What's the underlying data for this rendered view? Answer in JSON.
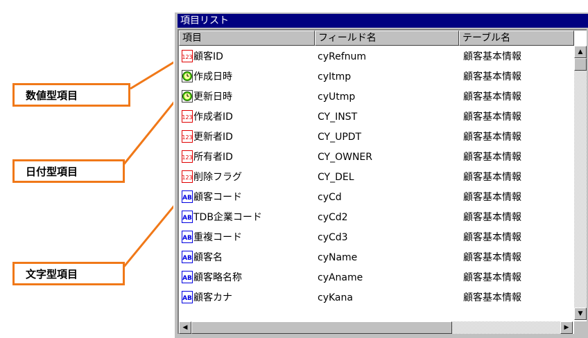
{
  "window": {
    "title": "項目リスト"
  },
  "columns": [
    "項目",
    "フィールド名",
    "テーブル名"
  ],
  "rows": [
    {
      "type": "number",
      "name": "顧客ID",
      "field": "cyRefnum",
      "table": "顧客基本情報"
    },
    {
      "type": "date",
      "name": "作成日時",
      "field": "cyItmp",
      "table": "顧客基本情報"
    },
    {
      "type": "date",
      "name": "更新日時",
      "field": "cyUtmp",
      "table": "顧客基本情報"
    },
    {
      "type": "number",
      "name": "作成者ID",
      "field": "CY_INST",
      "table": "顧客基本情報"
    },
    {
      "type": "number",
      "name": "更新者ID",
      "field": "CY_UPDT",
      "table": "顧客基本情報"
    },
    {
      "type": "number",
      "name": "所有者ID",
      "field": "CY_OWNER",
      "table": "顧客基本情報"
    },
    {
      "type": "number",
      "name": "削除フラグ",
      "field": "CY_DEL",
      "table": "顧客基本情報"
    },
    {
      "type": "text",
      "name": "顧客コード",
      "field": "cyCd",
      "table": "顧客基本情報"
    },
    {
      "type": "text",
      "name": "TDB企業コード",
      "field": "cyCd2",
      "table": "顧客基本情報"
    },
    {
      "type": "text",
      "name": "重複コード",
      "field": "cyCd3",
      "table": "顧客基本情報"
    },
    {
      "type": "text",
      "name": "顧客名",
      "field": "cyName",
      "table": "顧客基本情報"
    },
    {
      "type": "text",
      "name": "顧客略名称",
      "field": "cyAname",
      "table": "顧客基本情報"
    },
    {
      "type": "text",
      "name": "顧客カナ",
      "field": "cyKana",
      "table": "顧客基本情報"
    }
  ],
  "callouts": {
    "number": "数値型項目",
    "date": "日付型項目",
    "text": "文字型項目"
  },
  "icons": {
    "number": "number-type-icon",
    "date": "clock-icon",
    "text": "text-type-icon"
  },
  "colors": {
    "titlebar": "#000080",
    "callout_border": "#f07818",
    "number_icon": "#e00000",
    "date_icon": "#40c000",
    "text_icon": "#0000e0"
  }
}
